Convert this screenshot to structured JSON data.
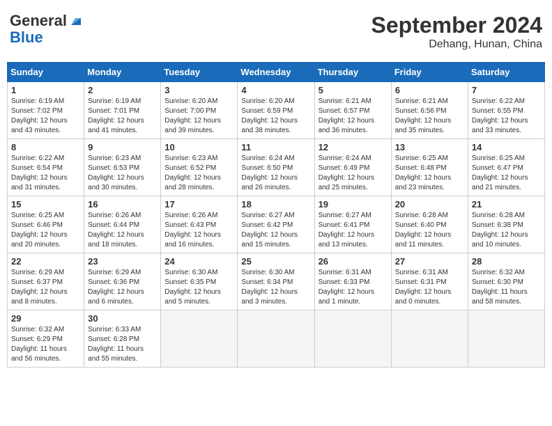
{
  "header": {
    "logo_general": "General",
    "logo_blue": "Blue",
    "month_title": "September 2024",
    "location": "Dehang, Hunan, China"
  },
  "days_of_week": [
    "Sunday",
    "Monday",
    "Tuesday",
    "Wednesday",
    "Thursday",
    "Friday",
    "Saturday"
  ],
  "weeks": [
    [
      {
        "day": "1",
        "info": "Sunrise: 6:19 AM\nSunset: 7:02 PM\nDaylight: 12 hours\nand 43 minutes."
      },
      {
        "day": "2",
        "info": "Sunrise: 6:19 AM\nSunset: 7:01 PM\nDaylight: 12 hours\nand 41 minutes."
      },
      {
        "day": "3",
        "info": "Sunrise: 6:20 AM\nSunset: 7:00 PM\nDaylight: 12 hours\nand 39 minutes."
      },
      {
        "day": "4",
        "info": "Sunrise: 6:20 AM\nSunset: 6:59 PM\nDaylight: 12 hours\nand 38 minutes."
      },
      {
        "day": "5",
        "info": "Sunrise: 6:21 AM\nSunset: 6:57 PM\nDaylight: 12 hours\nand 36 minutes."
      },
      {
        "day": "6",
        "info": "Sunrise: 6:21 AM\nSunset: 6:56 PM\nDaylight: 12 hours\nand 35 minutes."
      },
      {
        "day": "7",
        "info": "Sunrise: 6:22 AM\nSunset: 6:55 PM\nDaylight: 12 hours\nand 33 minutes."
      }
    ],
    [
      {
        "day": "8",
        "info": "Sunrise: 6:22 AM\nSunset: 6:54 PM\nDaylight: 12 hours\nand 31 minutes."
      },
      {
        "day": "9",
        "info": "Sunrise: 6:23 AM\nSunset: 6:53 PM\nDaylight: 12 hours\nand 30 minutes."
      },
      {
        "day": "10",
        "info": "Sunrise: 6:23 AM\nSunset: 6:52 PM\nDaylight: 12 hours\nand 28 minutes."
      },
      {
        "day": "11",
        "info": "Sunrise: 6:24 AM\nSunset: 6:50 PM\nDaylight: 12 hours\nand 26 minutes."
      },
      {
        "day": "12",
        "info": "Sunrise: 6:24 AM\nSunset: 6:49 PM\nDaylight: 12 hours\nand 25 minutes."
      },
      {
        "day": "13",
        "info": "Sunrise: 6:25 AM\nSunset: 6:48 PM\nDaylight: 12 hours\nand 23 minutes."
      },
      {
        "day": "14",
        "info": "Sunrise: 6:25 AM\nSunset: 6:47 PM\nDaylight: 12 hours\nand 21 minutes."
      }
    ],
    [
      {
        "day": "15",
        "info": "Sunrise: 6:25 AM\nSunset: 6:46 PM\nDaylight: 12 hours\nand 20 minutes."
      },
      {
        "day": "16",
        "info": "Sunrise: 6:26 AM\nSunset: 6:44 PM\nDaylight: 12 hours\nand 18 minutes."
      },
      {
        "day": "17",
        "info": "Sunrise: 6:26 AM\nSunset: 6:43 PM\nDaylight: 12 hours\nand 16 minutes."
      },
      {
        "day": "18",
        "info": "Sunrise: 6:27 AM\nSunset: 6:42 PM\nDaylight: 12 hours\nand 15 minutes."
      },
      {
        "day": "19",
        "info": "Sunrise: 6:27 AM\nSunset: 6:41 PM\nDaylight: 12 hours\nand 13 minutes."
      },
      {
        "day": "20",
        "info": "Sunrise: 6:28 AM\nSunset: 6:40 PM\nDaylight: 12 hours\nand 11 minutes."
      },
      {
        "day": "21",
        "info": "Sunrise: 6:28 AM\nSunset: 6:38 PM\nDaylight: 12 hours\nand 10 minutes."
      }
    ],
    [
      {
        "day": "22",
        "info": "Sunrise: 6:29 AM\nSunset: 6:37 PM\nDaylight: 12 hours\nand 8 minutes."
      },
      {
        "day": "23",
        "info": "Sunrise: 6:29 AM\nSunset: 6:36 PM\nDaylight: 12 hours\nand 6 minutes."
      },
      {
        "day": "24",
        "info": "Sunrise: 6:30 AM\nSunset: 6:35 PM\nDaylight: 12 hours\nand 5 minutes."
      },
      {
        "day": "25",
        "info": "Sunrise: 6:30 AM\nSunset: 6:34 PM\nDaylight: 12 hours\nand 3 minutes."
      },
      {
        "day": "26",
        "info": "Sunrise: 6:31 AM\nSunset: 6:33 PM\nDaylight: 12 hours\nand 1 minute."
      },
      {
        "day": "27",
        "info": "Sunrise: 6:31 AM\nSunset: 6:31 PM\nDaylight: 12 hours\nand 0 minutes."
      },
      {
        "day": "28",
        "info": "Sunrise: 6:32 AM\nSunset: 6:30 PM\nDaylight: 11 hours\nand 58 minutes."
      }
    ],
    [
      {
        "day": "29",
        "info": "Sunrise: 6:32 AM\nSunset: 6:29 PM\nDaylight: 11 hours\nand 56 minutes."
      },
      {
        "day": "30",
        "info": "Sunrise: 6:33 AM\nSunset: 6:28 PM\nDaylight: 11 hours\nand 55 minutes."
      },
      {
        "day": "",
        "info": ""
      },
      {
        "day": "",
        "info": ""
      },
      {
        "day": "",
        "info": ""
      },
      {
        "day": "",
        "info": ""
      },
      {
        "day": "",
        "info": ""
      }
    ]
  ]
}
